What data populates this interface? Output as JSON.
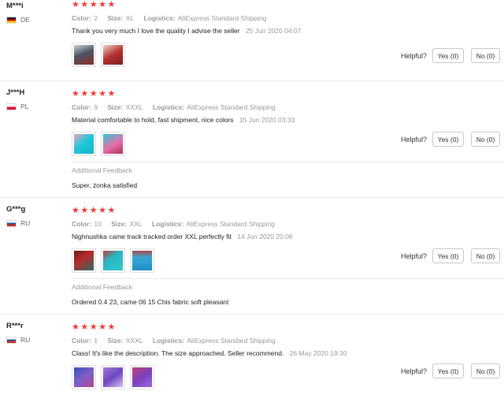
{
  "labels": {
    "color": "Color:",
    "size": "Size:",
    "logistics": "Logistics:",
    "helpful": "Helpful?",
    "additional_feedback": "Additional Feedback",
    "stars": "★★★★★"
  },
  "reviews": [
    {
      "user": "M***i",
      "country": "DE",
      "rating": 5,
      "color": "2",
      "size": "XL",
      "logistics": "AliExpress Standard Shipping",
      "comment": "Thank you very much I love the quality I advise the seller",
      "date": "25 Jun 2020 04:07",
      "photos": [
        "shirt-photo",
        "red-garment-photo"
      ],
      "helpful_yes": "Yes (0)",
      "helpful_no": "No (0)"
    },
    {
      "user": "J***H",
      "country": "PL",
      "rating": 5,
      "color": "9",
      "size": "XXXL",
      "logistics": "AliExpress Standard Shipping",
      "comment": "Material comfortable to hold, fast shipment, nice colors",
      "date": "15 Jun 2020 03:33",
      "photos": [
        "cyan-garment-photo",
        "pink-garment-photo"
      ],
      "helpful_yes": "Yes (0)",
      "helpful_no": "No (0)",
      "additional_feedback": "Super, żonka satisfied"
    },
    {
      "user": "G***g",
      "country": "RU",
      "rating": 5,
      "color": "10",
      "size": "XXL",
      "logistics": "AliExpress Standard Shipping",
      "comment": "Nighnushka came track tracked order XXL perfectly fit",
      "date": "14 Jun 2020 20:06",
      "photos": [
        "red-package-photo",
        "teal-package-photo",
        "blue-dress-photo"
      ],
      "helpful_yes": "Yes (0)",
      "helpful_no": "No (0)",
      "additional_feedback": "Ordered 0.4 23, came 06 15 Chis fabric soft pleasant"
    },
    {
      "user": "R***r",
      "country": "RU",
      "rating": 5,
      "color": "1",
      "size": "XXXL",
      "logistics": "AliExpress Standard Shipping",
      "comment": "Class! It's like the description. The size approached. Seller recommend.",
      "date": "26 May 2020 19:30",
      "photos": [
        "blue-set-photo",
        "purple-set-photo",
        "purple-dress-photo"
      ],
      "helpful_yes": "Yes (0)",
      "helpful_no": "No (0)"
    }
  ],
  "colors": {
    "star": "#f2383a",
    "muted_text": "#999999",
    "divider": "#e8e8e8",
    "button_border": "#c8c8c8"
  }
}
